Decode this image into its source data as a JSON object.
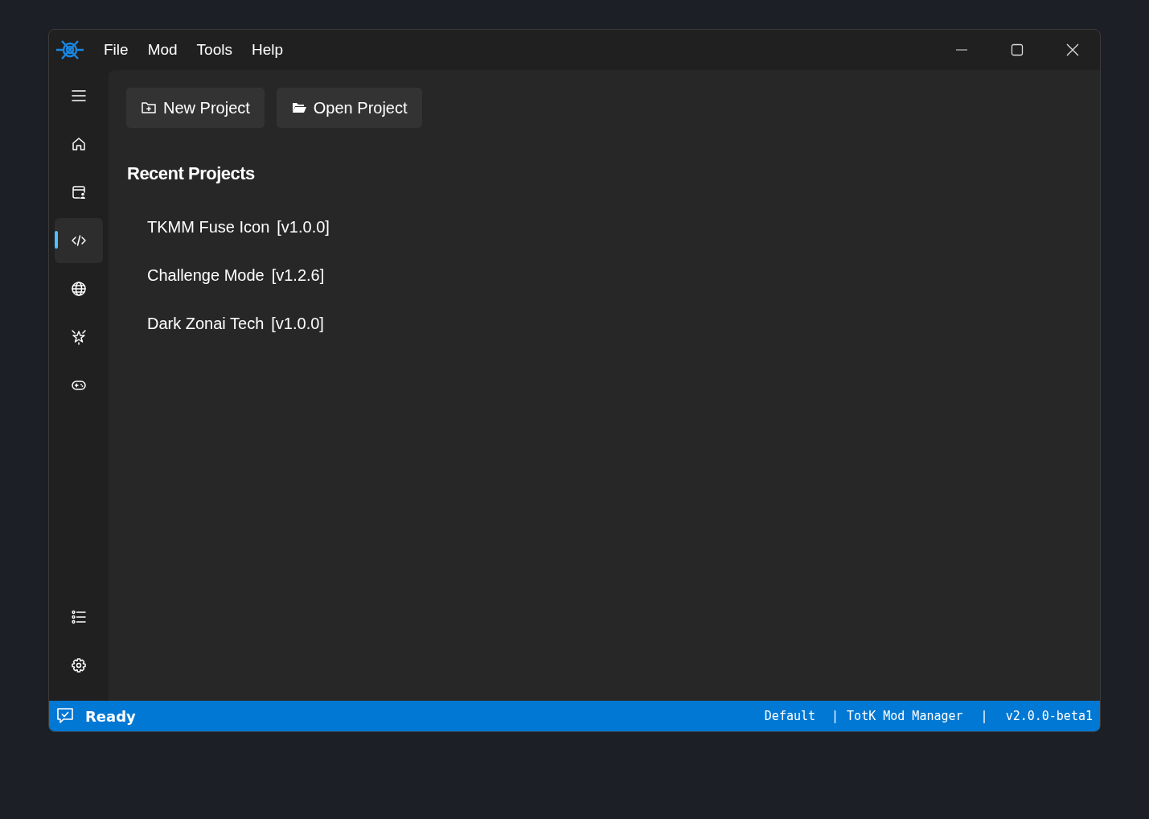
{
  "menu": [
    "File",
    "Mod",
    "Tools",
    "Help"
  ],
  "nav_items": [
    {
      "selected": false
    },
    {
      "selected": false
    },
    {
      "selected": false
    },
    {
      "selected": true
    },
    {
      "selected": false
    },
    {
      "selected": false
    },
    {
      "selected": false
    }
  ],
  "nav_footer_items": [
    {
      "selected": false
    },
    {
      "selected": false
    }
  ],
  "toolbar": [
    "New Project",
    "Open Project"
  ],
  "recent_title": "Recent Projects",
  "recent_projects": [
    {
      "name": "TKMM Fuse Icon",
      "version": "[v1.0.0]"
    },
    {
      "name": "Challenge Mode",
      "version": "[v1.2.6]"
    },
    {
      "name": "Dark Zonai Tech",
      "version": "[v1.0.0]"
    }
  ],
  "status_bar": {
    "message": "Ready",
    "profile": "Default",
    "separator_1": "|",
    "app_name": "TotK Mod Manager",
    "separator_2": "|",
    "version": "v2.0.0-beta1"
  }
}
